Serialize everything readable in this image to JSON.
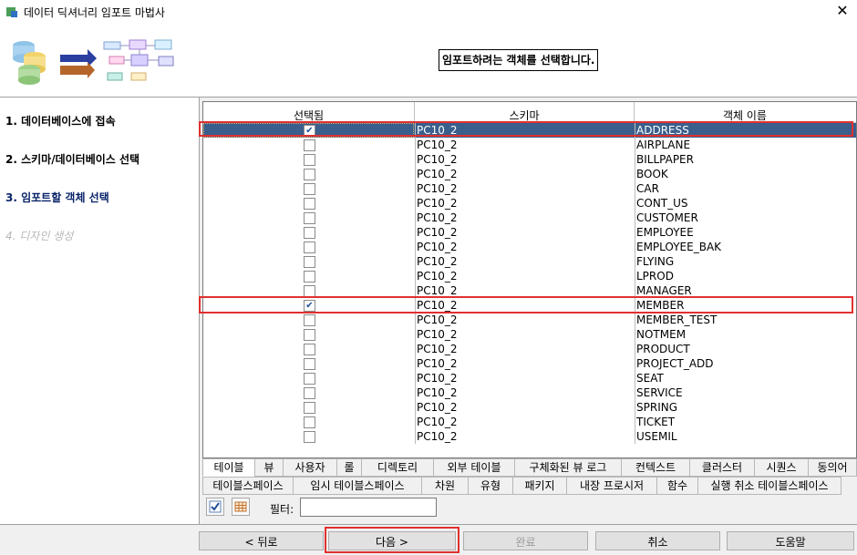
{
  "window": {
    "title": "데이터 딕셔너리 임포트 마법사",
    "close_glyph": "✕"
  },
  "banner": {
    "heading": "임포트하려는 객체를 선택합니다."
  },
  "steps": [
    "1. 데이터베이스에 접속",
    "2. 스키마/데이터베이스 선택",
    "3. 임포트할 객체 선택",
    "4. 디자인 생성"
  ],
  "grid": {
    "columns": [
      "선택됨",
      "스키마",
      "객체 이름"
    ],
    "rows": [
      {
        "checked": true,
        "schema": "PC10_2",
        "name": "ADDRESS",
        "selected": true
      },
      {
        "checked": false,
        "schema": "PC10_2",
        "name": "AIRPLANE"
      },
      {
        "checked": false,
        "schema": "PC10_2",
        "name": "BILLPAPER"
      },
      {
        "checked": false,
        "schema": "PC10_2",
        "name": "BOOK"
      },
      {
        "checked": false,
        "schema": "PC10_2",
        "name": "CAR"
      },
      {
        "checked": false,
        "schema": "PC10_2",
        "name": "CONT_US"
      },
      {
        "checked": false,
        "schema": "PC10_2",
        "name": "CUSTOMER"
      },
      {
        "checked": false,
        "schema": "PC10_2",
        "name": "EMPLOYEE"
      },
      {
        "checked": false,
        "schema": "PC10_2",
        "name": "EMPLOYEE_BAK"
      },
      {
        "checked": false,
        "schema": "PC10_2",
        "name": "FLYING"
      },
      {
        "checked": false,
        "schema": "PC10_2",
        "name": "LPROD"
      },
      {
        "checked": false,
        "schema": "PC10_2",
        "name": "MANAGER"
      },
      {
        "checked": true,
        "schema": "PC10_2",
        "name": "MEMBER"
      },
      {
        "checked": false,
        "schema": "PC10_2",
        "name": "MEMBER_TEST"
      },
      {
        "checked": false,
        "schema": "PC10_2",
        "name": "NOTMEM"
      },
      {
        "checked": false,
        "schema": "PC10_2",
        "name": "PRODUCT"
      },
      {
        "checked": false,
        "schema": "PC10_2",
        "name": "PROJECT_ADD"
      },
      {
        "checked": false,
        "schema": "PC10_2",
        "name": "SEAT"
      },
      {
        "checked": false,
        "schema": "PC10_2",
        "name": "SERVICE"
      },
      {
        "checked": false,
        "schema": "PC10_2",
        "name": "SPRING"
      },
      {
        "checked": false,
        "schema": "PC10_2",
        "name": "TICKET"
      },
      {
        "checked": false,
        "schema": "PC10_2",
        "name": "USEMIL"
      }
    ]
  },
  "tabs_row1": [
    "테이블",
    "뷰",
    "사용자",
    "롤",
    "디렉토리",
    "외부 테이블",
    "구체화된 뷰 로그",
    "컨텍스트",
    "클러스터",
    "시퀀스",
    "동의어"
  ],
  "tabs_row2": [
    "테이블스페이스",
    "임시 테이블스페이스",
    "차원",
    "유형",
    "패키지",
    "내장 프로시저",
    "함수",
    "실행 취소 테이블스페이스"
  ],
  "filter": {
    "label": "필터:",
    "value": ""
  },
  "buttons": {
    "back": "< 뒤로",
    "next": "다음 >",
    "finish": "완료",
    "cancel": "취소",
    "help": "도움말"
  },
  "check_glyph": "✔"
}
